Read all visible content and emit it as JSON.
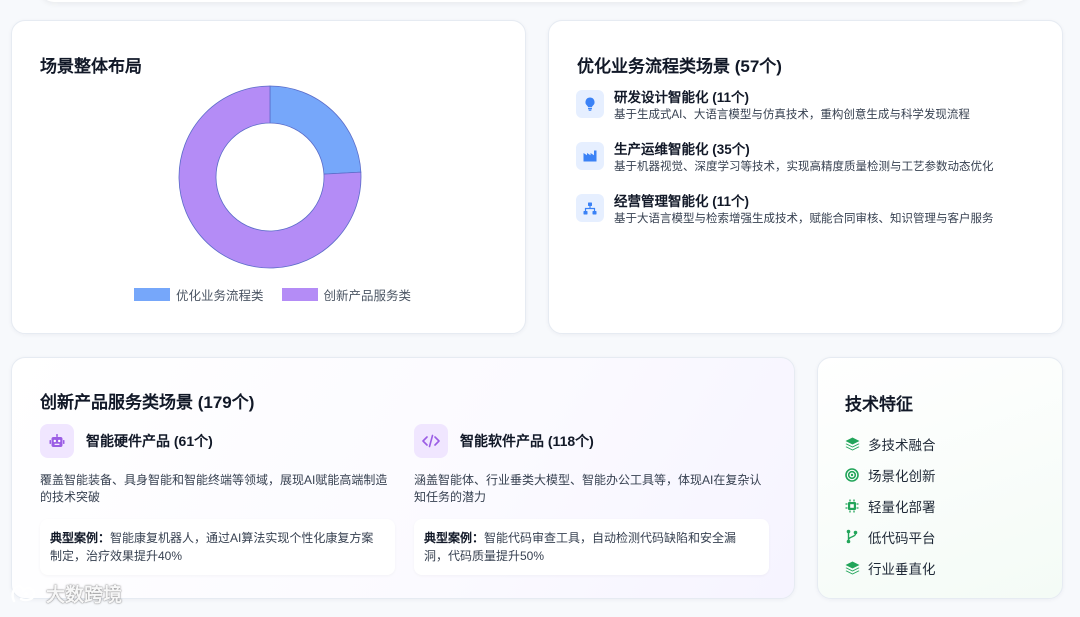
{
  "layout_card": {
    "title": "场景整体布局",
    "legend": [
      {
        "label": "优化业务流程类",
        "color": "#76a7fa"
      },
      {
        "label": "创新产品服务类",
        "color": "#b48cf6"
      }
    ]
  },
  "chart_data": {
    "type": "pie",
    "categories": [
      "优化业务流程类",
      "创新产品服务类"
    ],
    "values": [
      57,
      179
    ],
    "colors": [
      "#76a7fa",
      "#b48cf6"
    ],
    "legend_position": "bottom"
  },
  "optimization": {
    "title": "优化业务流程类场景 (57个)",
    "items": [
      {
        "icon": "lightbulb-icon",
        "title": "研发设计智能化 (11个)",
        "desc": "基于生成式AI、大语言模型与仿真技术，重构创意生成与科学发现流程"
      },
      {
        "icon": "factory-icon",
        "title": "生产运维智能化 (35个)",
        "desc": "基于机器视觉、深度学习等技术，实现高精度质量检测与工艺参数动态优化"
      },
      {
        "icon": "org-chart-icon",
        "title": "经营管理智能化 (11个)",
        "desc": "基于大语言模型与检索增强生成技术，赋能合同审核、知识管理与客户服务"
      }
    ]
  },
  "innovation": {
    "title": "创新产品服务类场景 (179个)",
    "products": [
      {
        "icon": "robot-icon",
        "title": "智能硬件产品 (61个)",
        "desc": "覆盖智能装备、具身智能和智能终端等领域，展现AI赋能高端制造的技术突破",
        "case_label": "典型案例：",
        "case_text": "智能康复机器人，通过AI算法实现个性化康复方案制定，治疗效果提升40%"
      },
      {
        "icon": "code-icon",
        "title": "智能软件产品 (118个)",
        "desc": "涵盖智能体、行业垂类大模型、智能办公工具等，体现AI在复杂认知任务的潜力",
        "case_label": "典型案例：",
        "case_text": "智能代码审查工具，自动检测代码缺陷和安全漏洞，代码质量提升50%"
      }
    ]
  },
  "tech": {
    "title": "技术特征",
    "items": [
      {
        "icon": "layers-icon",
        "label": "多技术融合"
      },
      {
        "icon": "target-icon",
        "label": "场景化创新"
      },
      {
        "icon": "chip-icon",
        "label": "轻量化部署"
      },
      {
        "icon": "branch-icon",
        "label": "低代码平台"
      },
      {
        "icon": "layers-icon",
        "label": "行业垂直化"
      }
    ],
    "accent": "#22a55a"
  },
  "watermark": {
    "text": "大数跨境"
  }
}
